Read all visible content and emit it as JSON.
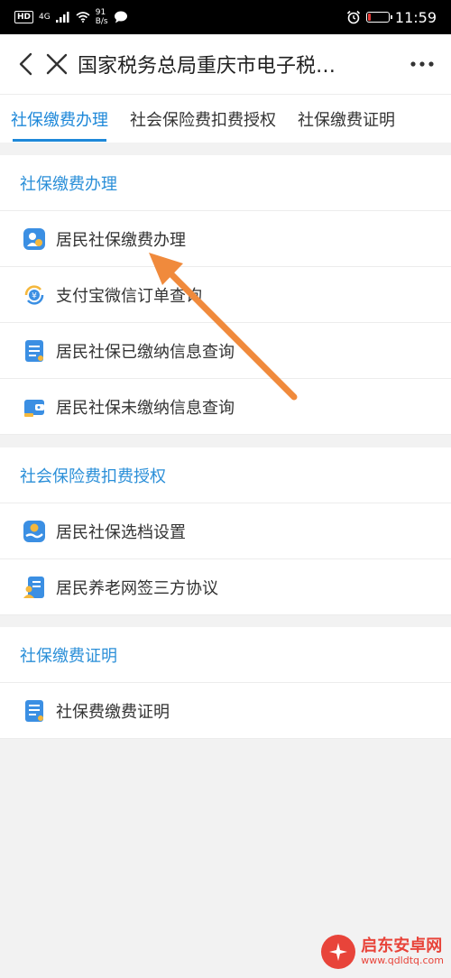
{
  "status_bar": {
    "hd": "HD",
    "network": "4G",
    "speed_value": "91",
    "speed_unit": "B/s",
    "time": "11:59",
    "battery_level": 0.15,
    "battery_color": "#e53935"
  },
  "title_bar": {
    "back_icon": "chevron-left-icon",
    "close_icon": "close-icon",
    "title": "国家税务总局重庆市电子税…",
    "more_icon": "more-icon"
  },
  "tabs": [
    {
      "label": "社保缴费办理",
      "active": true
    },
    {
      "label": "社会保险费扣费授权",
      "active": false
    },
    {
      "label": "社保缴费证明",
      "active": false
    }
  ],
  "sections": [
    {
      "header": "社保缴费办理",
      "items": [
        {
          "label": "居民社保缴费办理",
          "icon": "person-payment-icon"
        },
        {
          "label": "支付宝微信订单查询",
          "icon": "yuan-refresh-icon"
        },
        {
          "label": "居民社保已缴纳信息查询",
          "icon": "document-list-icon"
        },
        {
          "label": "居民社保未缴纳信息查询",
          "icon": "wallet-icon"
        }
      ]
    },
    {
      "header": "社会保险费扣费授权",
      "items": [
        {
          "label": "居民社保选档设置",
          "icon": "hand-coin-icon"
        },
        {
          "label": "居民养老网签三方协议",
          "icon": "contract-person-icon"
        }
      ]
    },
    {
      "header": "社保缴费证明",
      "items": [
        {
          "label": "社保费缴费证明",
          "icon": "certificate-icon"
        }
      ]
    }
  ],
  "watermark": {
    "title": "启东安卓网",
    "url": "www.qdldtq.com"
  },
  "colors": {
    "accent": "#1e88d9",
    "section_header": "#2b8fd8",
    "arrow": "#f08a3c",
    "icon_blue": "#3b8fe3",
    "icon_yellow": "#f5b83d"
  }
}
